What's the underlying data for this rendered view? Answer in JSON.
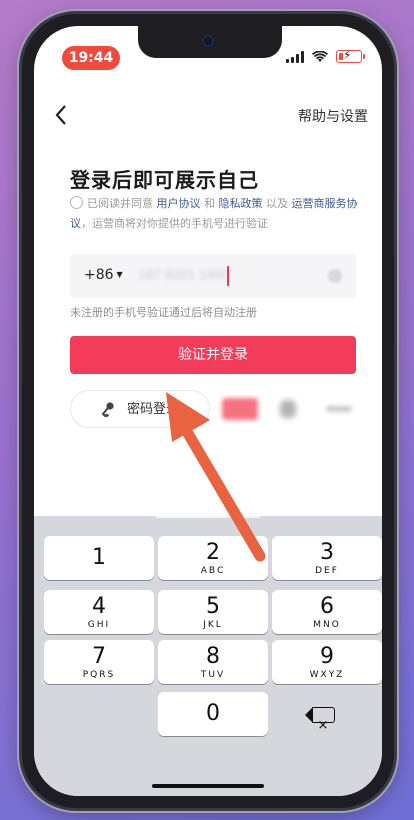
{
  "status_bar": {
    "time": "19:44"
  },
  "header": {
    "back_icon": "chevron-left-icon",
    "help_label": "帮助与设置"
  },
  "main": {
    "title": "登录后即可展示自己",
    "agreement": {
      "prefix": "已阅读并同意",
      "link_user": "用户协议",
      "and": "和",
      "link_privacy": "隐私政策",
      "and2": "以及",
      "link_carrier": "运营商服务协议",
      "suffix": "，运营商将对你提供的手机号进行验证"
    },
    "country_code": "+86",
    "phone_value": "187 8201 1495",
    "hint": "未注册的手机号验证通过后将自动注册",
    "login_button": "验证并登录",
    "password_login": "密码登录"
  },
  "keyboard": {
    "keys": [
      {
        "num": "1",
        "letters": ""
      },
      {
        "num": "2",
        "letters": "ABC"
      },
      {
        "num": "3",
        "letters": "DEF"
      },
      {
        "num": "4",
        "letters": "GHI"
      },
      {
        "num": "5",
        "letters": "JKL"
      },
      {
        "num": "6",
        "letters": "MNO"
      },
      {
        "num": "7",
        "letters": "PQRS"
      },
      {
        "num": "8",
        "letters": "TUV"
      },
      {
        "num": "9",
        "letters": "WXYZ"
      },
      {
        "num": "0",
        "letters": ""
      }
    ]
  },
  "colors": {
    "accent": "#f23c5a",
    "link": "#3d5a9a",
    "arrow": "#e8633f"
  }
}
